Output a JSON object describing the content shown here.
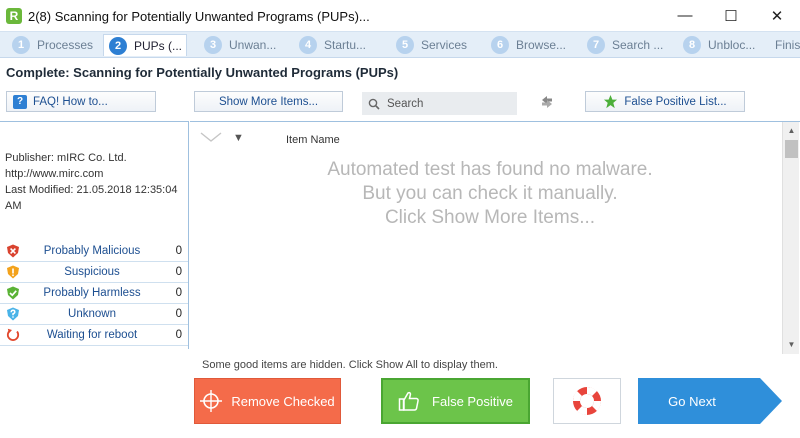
{
  "window": {
    "app_badge": "R",
    "title": "2(8) Scanning for Potentially Unwanted Programs (PUPs)...",
    "minimize": "—",
    "maximize": "☐",
    "close": "✕"
  },
  "steps": [
    {
      "num": "1",
      "label": "Processes"
    },
    {
      "num": "2",
      "label": "PUPs (..."
    },
    {
      "num": "3",
      "label": "Unwan..."
    },
    {
      "num": "4",
      "label": "Startu..."
    },
    {
      "num": "5",
      "label": "Services"
    },
    {
      "num": "6",
      "label": "Browse..."
    },
    {
      "num": "7",
      "label": "Search ..."
    },
    {
      "num": "8",
      "label": "Unbloc..."
    },
    {
      "num": "",
      "label": "Finis"
    }
  ],
  "headline": "Complete: Scanning for Potentially Unwanted Programs (PUPs)",
  "toolbar": {
    "faq_icon": "?",
    "faq_label": "FAQ! How to...",
    "show_more_label": "Show More Items...",
    "search_placeholder": "Search",
    "false_positive_list_label": "False Positive List..."
  },
  "publisher": {
    "publisher_line": "Publisher: mIRC Co. Ltd.",
    "url_line": "http://www.mirc.com",
    "modified_line": "Last Modified: 21.05.2018 12:35:04 AM"
  },
  "statuses": [
    {
      "label": "Probably Malicious",
      "count": "0",
      "color": "#d9432f"
    },
    {
      "label": "Suspicious",
      "count": "0",
      "color": "#f3a21b"
    },
    {
      "label": "Probably Harmless",
      "count": "0",
      "color": "#5bb336"
    },
    {
      "label": "Unknown",
      "count": "0",
      "color": "#49b3e8"
    },
    {
      "label": "Waiting for reboot",
      "count": "0",
      "color": "#e2482d"
    }
  ],
  "list": {
    "column_name": "Item Name",
    "empty_line1": "Automated test has found no malware.",
    "empty_line2": "But you can check it manually.",
    "empty_line3": "Click Show More Items..."
  },
  "hidden_note": "Some good items are hidden. Click Show All to display them.",
  "buttons": {
    "remove_checked": "Remove Checked",
    "false_positive": "False Positive",
    "go_next": "Go Next"
  },
  "colors": {
    "accent": "#2d7fd3",
    "remove": "#f46b4a",
    "false_positive": "#6cc44a",
    "next": "#2f8fda"
  }
}
